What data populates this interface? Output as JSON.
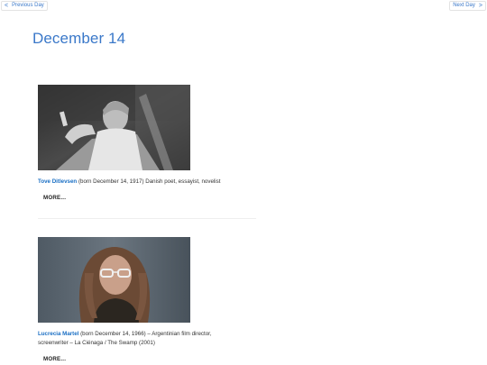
{
  "nav": {
    "prev_arrow": "<",
    "prev_label": "Previous Day",
    "next_label": "Next Day",
    "next_arrow": ">"
  },
  "page": {
    "title": "December 14"
  },
  "entries": [
    {
      "name": "Tove Ditlevsen",
      "description": " (born December 14, 1917) Danish poet, essayist, novelist",
      "more": "MORE..."
    },
    {
      "name": "Lucrecia Martel",
      "description": " (born December 14, 1966) – Argentinian film director, screenwriter – La Ciénaga / The Swamp (2001)",
      "more": "MORE..."
    }
  ],
  "colors": {
    "link": "#3a78c9",
    "name": "#1a6fc4",
    "text": "#333333"
  },
  "icons": {
    "prev": "chevron-left-icon",
    "next": "chevron-right-icon"
  }
}
